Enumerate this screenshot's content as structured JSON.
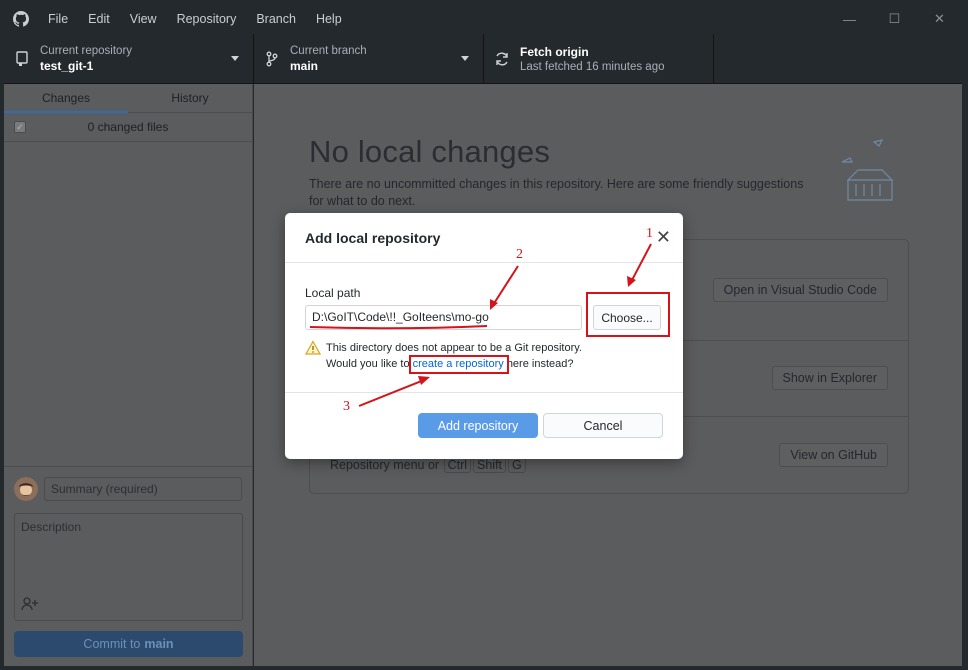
{
  "menu": [
    "File",
    "Edit",
    "View",
    "Repository",
    "Branch",
    "Help"
  ],
  "window_controls": {
    "minimize": "—",
    "maximize": "☐",
    "close": "✕"
  },
  "toolbar": {
    "repo_label": "Current repository",
    "repo_value": "test_git-1",
    "branch_label": "Current branch",
    "branch_value": "main",
    "fetch_title": "Fetch origin",
    "fetch_sub": "Last fetched 16 minutes ago"
  },
  "sidebar": {
    "tabs": [
      "Changes",
      "History"
    ],
    "changed_files": "0 changed files",
    "summary_placeholder": "Summary (required)",
    "description_placeholder": "Description",
    "commit_prefix": "Commit to",
    "commit_branch": "main"
  },
  "main": {
    "title": "No local changes",
    "description": "There are no uncommitted changes in this repository. Here are some friendly suggestions for what to do next.",
    "open_editor_button": "Open in Visual Studio Code",
    "show_explorer_button": "Show in Explorer",
    "view_github_button": "View on GitHub",
    "repo_menu_hint": "Repository menu or",
    "keys": [
      "Ctrl",
      "Shift",
      "G"
    ]
  },
  "dialog": {
    "title": "Add local repository",
    "close": "✕",
    "local_path_label": "Local path",
    "local_path_value": "D:\\GoIT\\Code\\!!_GoIteens\\mo-go",
    "choose_button": "Choose...",
    "warning_line1": "This directory does not appear to be a Git repository.",
    "warning_line2_pre": "Would you like to",
    "warning_link": "create a repository",
    "warning_line2_post": "here instead?",
    "add_button": "Add repository",
    "cancel_button": "Cancel"
  },
  "annotations": {
    "n1": "1",
    "n2": "2",
    "n3": "3"
  },
  "colors": {
    "accent": "#2f6db5",
    "primary_button": "#5a9be8",
    "link": "#0366d6",
    "annotation": "#d4141a"
  }
}
